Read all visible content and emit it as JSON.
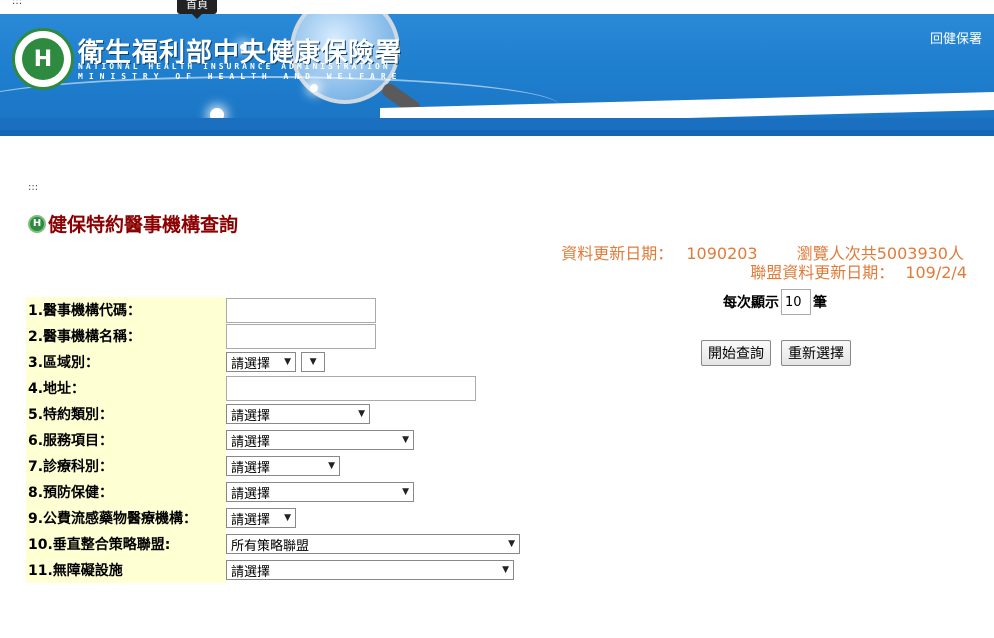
{
  "top_dots": ":::",
  "tooltip_text": "首頁",
  "banner": {
    "title": "衛生福利部中央健康保險署",
    "en_line1": "NATIONAL HEALTH INSURANCE ADMINISTRATION",
    "en_line2": "MINISTRY OF HEALTH AND WELFARE",
    "logo_letter": "H",
    "back_link": "回健保署"
  },
  "mid_dots": ":::",
  "page_title": "健保特約醫事機構查詢",
  "title_icon_letter": "H",
  "info": {
    "update_label": "資料更新日期：",
    "update_value": "1090203",
    "views_label": "瀏覽人次共",
    "views_value": "5003930",
    "views_unit": "人",
    "alliance_label": "聯盟資料更新日期：",
    "alliance_value": "109/2/4"
  },
  "form": {
    "rows": [
      {
        "label": "1.醫事機構代碼："
      },
      {
        "label": "2.醫事機構名稱："
      },
      {
        "label": "3.區域別：",
        "select1": "請選擇",
        "select2": ""
      },
      {
        "label": "4.地址："
      },
      {
        "label": "5.特約類別：",
        "select": "請選擇"
      },
      {
        "label": "6.服務項目：",
        "select": "請選擇"
      },
      {
        "label": "7.診療科別：",
        "select": "請選擇"
      },
      {
        "label": "8.預防保健：",
        "select": "請選擇"
      },
      {
        "label": "9.公費流感藥物醫療機構：",
        "select": "請選擇"
      },
      {
        "label": "10.垂直整合策略聯盟:",
        "select": "所有策略聯盟"
      },
      {
        "label": "11.無障礙設施",
        "select": "請選擇"
      }
    ]
  },
  "per_page": {
    "label": "每次顯示",
    "value": "10",
    "unit": "筆"
  },
  "buttons": {
    "search": "開始查詢",
    "reset": "重新選擇"
  }
}
